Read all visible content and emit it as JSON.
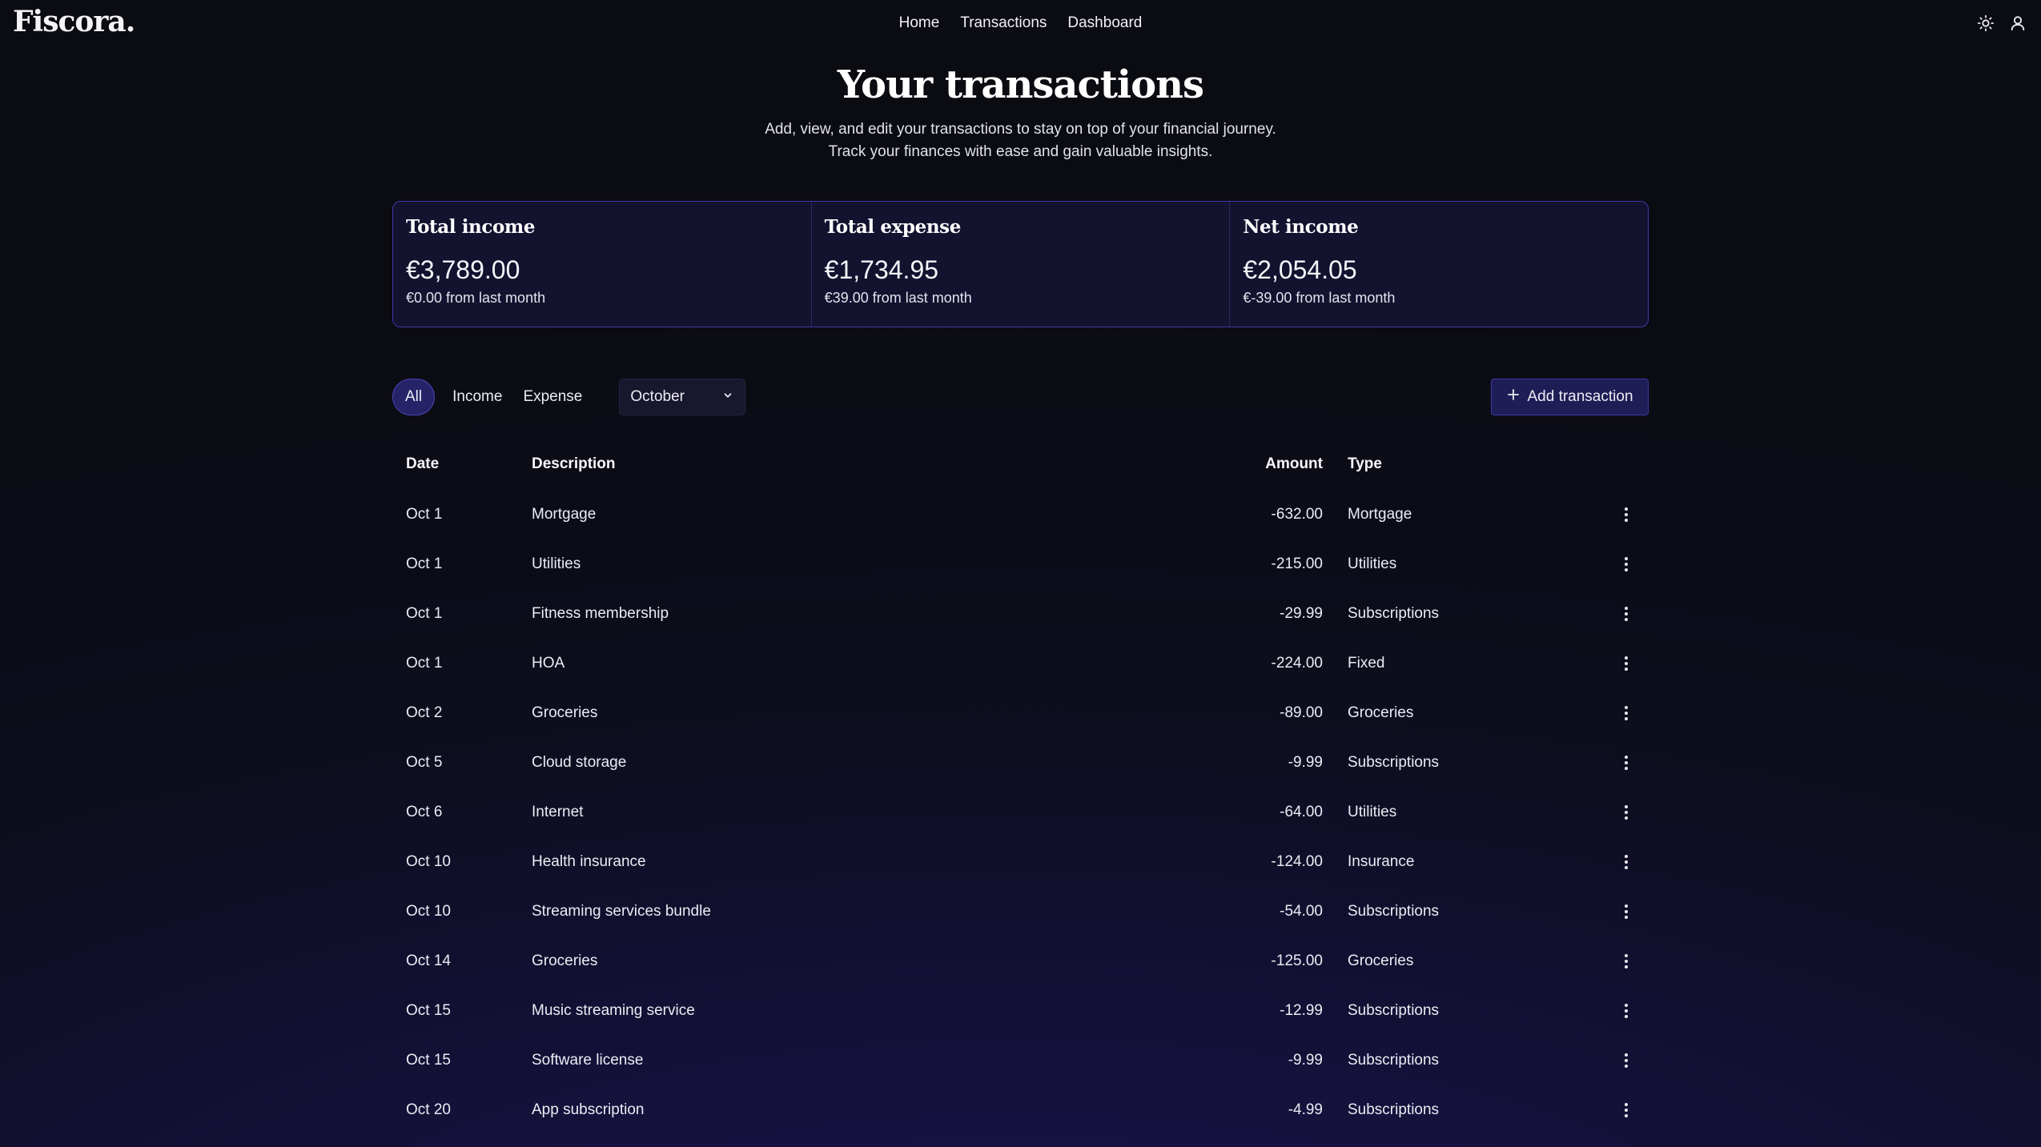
{
  "header": {
    "logo": "Fiscora.",
    "nav": [
      "Home",
      "Transactions",
      "Dashboard"
    ],
    "icons": [
      "sun-icon",
      "user-icon"
    ]
  },
  "hero": {
    "title": "Your transactions",
    "subtitle_line1": "Add, view, and edit your transactions to stay on top of your financial journey.",
    "subtitle_line2": "Track your finances with ease and gain valuable insights."
  },
  "summary": [
    {
      "title": "Total income",
      "value": "€3,789.00",
      "delta": "€0.00 from last month"
    },
    {
      "title": "Total expense",
      "value": "€1,734.95",
      "delta": "€39.00 from last month"
    },
    {
      "title": "Net income",
      "value": "€2,054.05",
      "delta": "€-39.00 from last month"
    }
  ],
  "filters": {
    "tabs": [
      "All",
      "Income",
      "Expense"
    ],
    "active_tab": "All",
    "month": "October",
    "add_label": "Add transaction"
  },
  "table": {
    "columns": [
      "Date",
      "Description",
      "Amount",
      "Type"
    ],
    "rows": [
      {
        "date": "Oct 1",
        "description": "Mortgage",
        "amount": "-632.00",
        "type": "Mortgage"
      },
      {
        "date": "Oct 1",
        "description": "Utilities",
        "amount": "-215.00",
        "type": "Utilities"
      },
      {
        "date": "Oct 1",
        "description": "Fitness membership",
        "amount": "-29.99",
        "type": "Subscriptions"
      },
      {
        "date": "Oct 1",
        "description": "HOA",
        "amount": "-224.00",
        "type": "Fixed"
      },
      {
        "date": "Oct 2",
        "description": "Groceries",
        "amount": "-89.00",
        "type": "Groceries"
      },
      {
        "date": "Oct 5",
        "description": "Cloud storage",
        "amount": "-9.99",
        "type": "Subscriptions"
      },
      {
        "date": "Oct 6",
        "description": "Internet",
        "amount": "-64.00",
        "type": "Utilities"
      },
      {
        "date": "Oct 10",
        "description": "Health insurance",
        "amount": "-124.00",
        "type": "Insurance"
      },
      {
        "date": "Oct 10",
        "description": "Streaming services bundle",
        "amount": "-54.00",
        "type": "Subscriptions"
      },
      {
        "date": "Oct 14",
        "description": "Groceries",
        "amount": "-125.00",
        "type": "Groceries"
      },
      {
        "date": "Oct 15",
        "description": "Music streaming service",
        "amount": "-12.99",
        "type": "Subscriptions"
      },
      {
        "date": "Oct 15",
        "description": "Software license",
        "amount": "-9.99",
        "type": "Subscriptions"
      },
      {
        "date": "Oct 20",
        "description": "App subscription",
        "amount": "-4.99",
        "type": "Subscriptions"
      }
    ]
  }
}
